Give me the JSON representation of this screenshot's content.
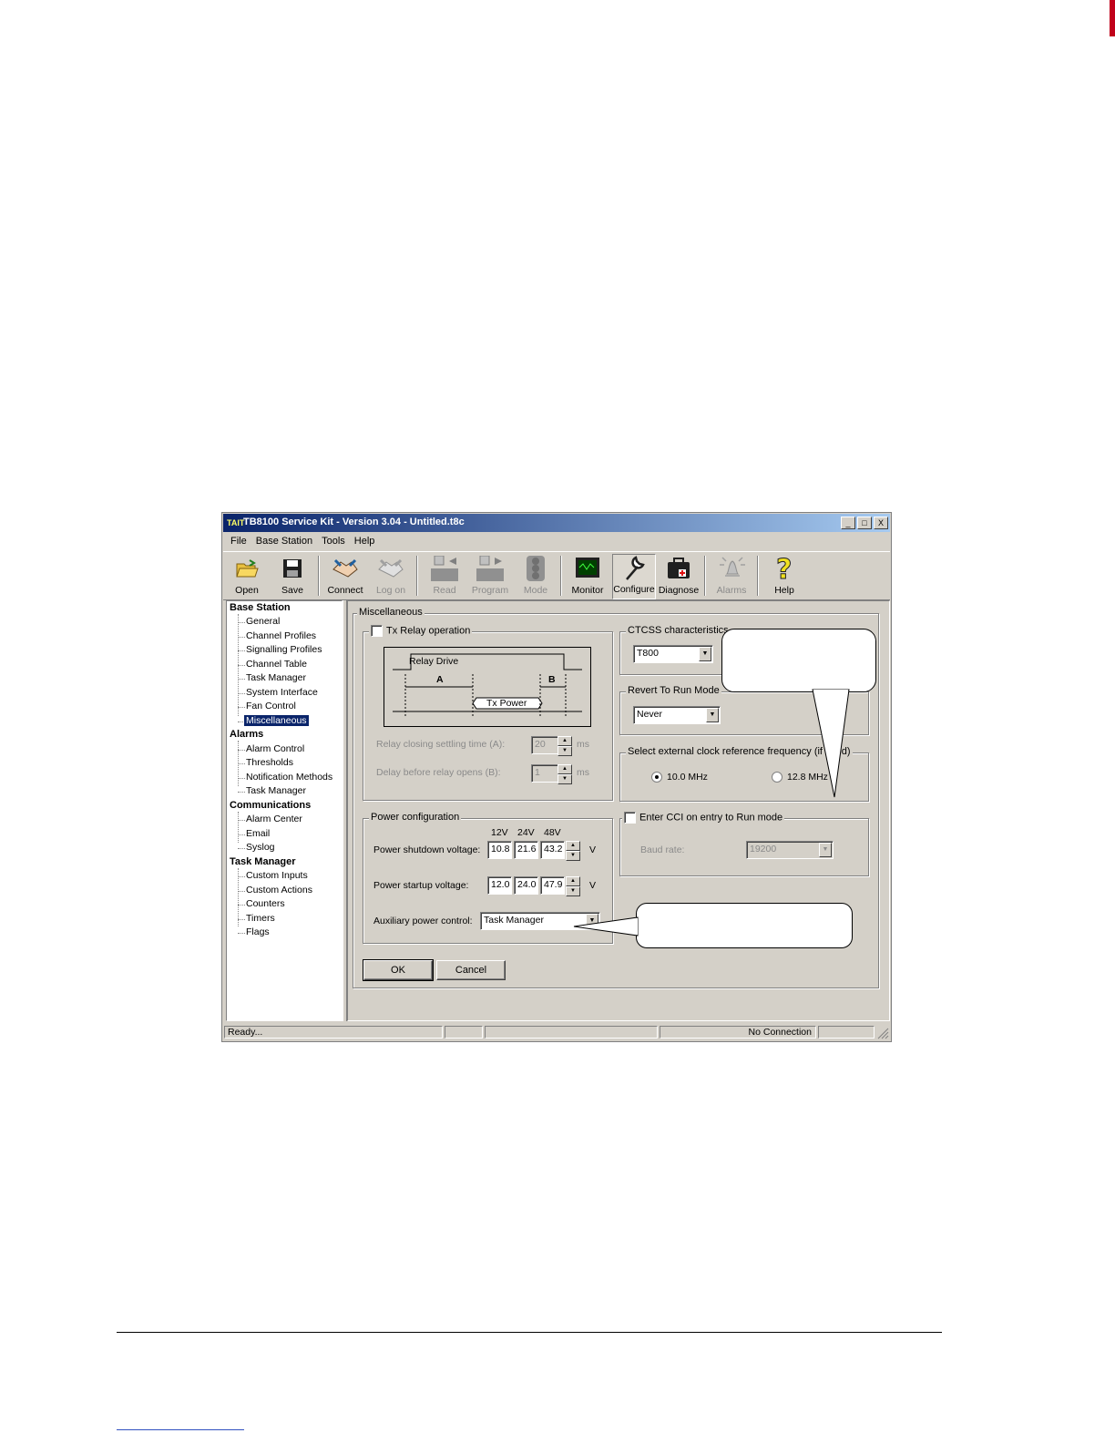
{
  "window": {
    "title": "TB8100 Service Kit - Version 3.04 - Untitled.t8c",
    "logo_text": "TAIT",
    "controls": [
      "_",
      "□",
      "X"
    ]
  },
  "menu": [
    {
      "label": "File"
    },
    {
      "label": "Base Station"
    },
    {
      "label": "Tools"
    },
    {
      "label": "Help"
    }
  ],
  "toolbar": {
    "open": "Open",
    "save": "Save",
    "connect": "Connect",
    "logon": "Log on",
    "read": "Read",
    "program": "Program",
    "mode": "Mode",
    "monitor": "Monitor",
    "configure": "Configure",
    "diagnose": "Diagnose",
    "alarms": "Alarms",
    "help": "Help"
  },
  "tree": {
    "base_station": "Base Station",
    "base_items": [
      "General",
      "Channel Profiles",
      "Signalling Profiles",
      "Channel Table",
      "Task Manager",
      "System Interface",
      "Fan Control",
      "Miscellaneous"
    ],
    "alarms": "Alarms",
    "alarm_items": [
      "Alarm Control",
      "Thresholds",
      "Notification Methods",
      "Task Manager"
    ],
    "communications": "Communications",
    "comm_items": [
      "Alarm Center",
      "Email",
      "Syslog"
    ],
    "task_manager": "Task Manager",
    "task_items": [
      "Custom Inputs",
      "Custom Actions",
      "Counters",
      "Timers",
      "Flags"
    ]
  },
  "misc": {
    "title": "Miscellaneous",
    "tx_relay_label": "Tx Relay operation",
    "relay_drive": "Relay Drive",
    "label_a": "A",
    "label_b": "B",
    "tx_power": "Tx Power",
    "relay_closing_label": "Relay closing settling time (A):",
    "relay_closing_value": "20",
    "delay_label": "Delay before relay opens (B):",
    "delay_value": "1",
    "unit_ms": "ms"
  },
  "power": {
    "title": "Power configuration",
    "col_12": "12V",
    "col_24": "24V",
    "col_48": "48V",
    "shutdown_label": "Power shutdown voltage:",
    "shutdown": [
      "10.8",
      "21.6",
      "43.2"
    ],
    "startup_label": "Power startup voltage:",
    "startup": [
      "12.0",
      "24.0",
      "47.9"
    ],
    "unit_v": "V",
    "aux_label": "Auxiliary power control:",
    "aux_value": "Task Manager"
  },
  "ctcss": {
    "title": "CTCSS characteristics",
    "value": "T800"
  },
  "revert": {
    "title": "Revert To Run Mode",
    "value": "Never"
  },
  "clock": {
    "title": "Select external clock reference frequency (if fitted)",
    "option1": "10.0 MHz",
    "option2": "12.8 MHz"
  },
  "cci": {
    "label": "Enter CCI on entry to Run mode",
    "baud_label": "Baud rate:",
    "baud_value": "19200"
  },
  "buttons": {
    "ok": "OK",
    "cancel": "Cancel"
  },
  "status": {
    "ready": "Ready...",
    "connection": "No Connection"
  }
}
